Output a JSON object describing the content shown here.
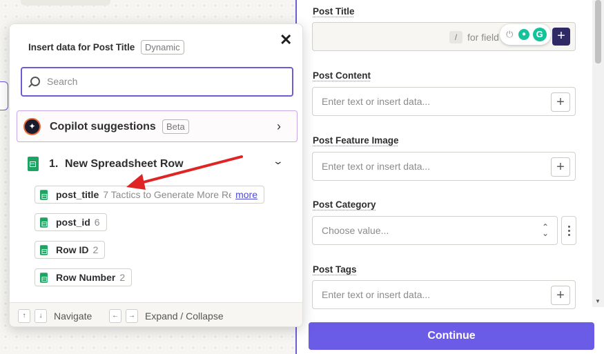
{
  "popover": {
    "title": "Insert data for Post Title",
    "badge": "Dynamic",
    "close": "✕",
    "search": {
      "placeholder": "Search",
      "value": ""
    },
    "copilot": {
      "label": "Copilot suggestions",
      "badge": "Beta",
      "chevron": "›"
    },
    "step": {
      "number": "1.",
      "name": "New Spreadsheet Row"
    },
    "fields": [
      {
        "key": "post_title",
        "value": "7 Tactics to Generate More Re",
        "more": "more"
      },
      {
        "key": "post_id",
        "value": "6"
      },
      {
        "key": "Row ID",
        "value": "2"
      },
      {
        "key": "Row Number",
        "value": "2"
      }
    ],
    "footer": {
      "up": "↑",
      "down": "↓",
      "navigate": "Navigate",
      "left": "←",
      "right": "→",
      "expand": "Expand / Collapse"
    }
  },
  "form": {
    "post_title": {
      "label": "Post Title",
      "slash": "/",
      "hint": "for field"
    },
    "post_content": {
      "label": "Post Content",
      "placeholder": "Enter text or insert data..."
    },
    "post_feature_image": {
      "label": "Post Feature Image",
      "placeholder": "Enter text or insert data..."
    },
    "post_category": {
      "label": "Post Category",
      "placeholder": "Choose value..."
    },
    "post_tags": {
      "label": "Post Tags",
      "placeholder": "Enter text or insert data..."
    },
    "plus": "+",
    "continue": "Continue"
  },
  "grammarly": {
    "logo": "G"
  },
  "colors": {
    "accent": "#6b5ce7",
    "border_accent": "#6b5cd6",
    "sheets_green": "#1ea362",
    "annotation_arrow": "#e02424"
  }
}
